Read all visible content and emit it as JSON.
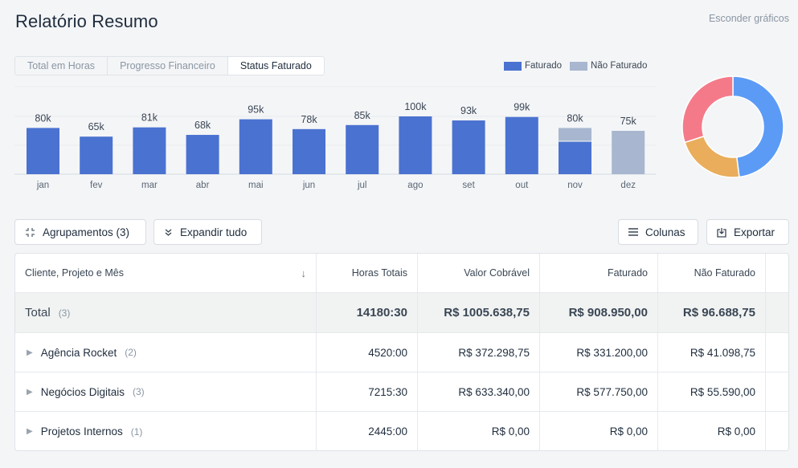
{
  "header": {
    "title": "Relatório Resumo",
    "hide_charts": "Esconder gráficos"
  },
  "tabs": [
    {
      "label": "Total em Horas",
      "active": false
    },
    {
      "label": "Progresso Financeiro",
      "active": false
    },
    {
      "label": "Status Faturado",
      "active": true
    }
  ],
  "legend": [
    {
      "label": "Faturado",
      "color": "#4a72d0"
    },
    {
      "label": "Não Faturado",
      "color": "#a8b7cf"
    }
  ],
  "chart_data": [
    {
      "type": "bar",
      "categories": [
        "jan",
        "fev",
        "mar",
        "abr",
        "mai",
        "jun",
        "jul",
        "ago",
        "set",
        "out",
        "nov",
        "dez"
      ],
      "data_labels": [
        "80k",
        "65k",
        "81k",
        "68k",
        "95k",
        "78k",
        "85k",
        "100k",
        "93k",
        "99k",
        "80k",
        "75k"
      ],
      "series": [
        {
          "name": "Faturado",
          "values": [
            80,
            65,
            81,
            68,
            95,
            78,
            85,
            100,
            93,
            99,
            57,
            0
          ]
        },
        {
          "name": "Não Faturado",
          "values": [
            0,
            0,
            0,
            0,
            0,
            0,
            0,
            0,
            0,
            0,
            23,
            75
          ]
        }
      ],
      "ylim": [
        0,
        100
      ]
    },
    {
      "type": "pie",
      "values": [
        48,
        22,
        30
      ],
      "colors": [
        "#5b9bf5",
        "#e9ad5b",
        "#f47a8a"
      ]
    }
  ],
  "toolbar": {
    "groupings": "Agrupamentos (3)",
    "expand_all": "Expandir tudo",
    "columns": "Colunas",
    "export": "Exportar"
  },
  "table": {
    "headers": [
      "Cliente, Projeto e Mês",
      "Horas Totais",
      "Valor Cobrável",
      "Faturado",
      "Não Faturado"
    ],
    "total": {
      "name": "Total",
      "count": "(3)",
      "hours": "14180:30",
      "billable": "R$ 1005.638,75",
      "invoiced": "R$ 908.950,00",
      "uninvoiced": "R$ 96.688,75"
    },
    "rows": [
      {
        "name": "Agência Rocket",
        "count": "(2)",
        "hours": "4520:00",
        "billable": "R$ 372.298,75",
        "invoiced": "R$ 331.200,00",
        "uninvoiced": "R$ 41.098,75"
      },
      {
        "name": "Negócios Digitais",
        "count": "(3)",
        "hours": "7215:30",
        "billable": "R$ 633.340,00",
        "invoiced": "R$ 577.750,00",
        "uninvoiced": "R$ 55.590,00"
      },
      {
        "name": "Projetos Internos",
        "count": "(1)",
        "hours": "2445:00",
        "billable": "R$ 0,00",
        "invoiced": "R$ 0,00",
        "uninvoiced": "R$ 0,00"
      }
    ]
  }
}
